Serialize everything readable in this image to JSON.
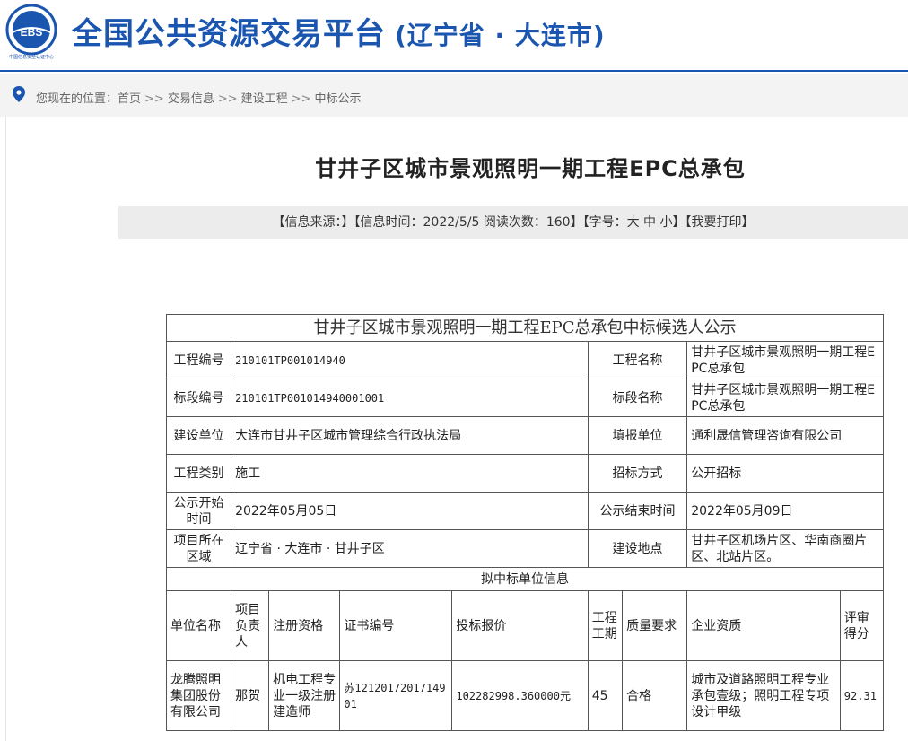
{
  "header": {
    "logo_text": "EBS",
    "logo_caption": "中国信息安全认证中心",
    "site_title": "全国公共资源交易平台",
    "region": "(辽宁省 · 大连市)"
  },
  "breadcrumb": {
    "prefix": "您现在的位置：",
    "items": [
      "首页",
      "交易信息",
      "建设工程",
      "中标公示"
    ],
    "separator": ">>"
  },
  "article": {
    "title": "甘井子区城市景观照明一期工程EPC总承包",
    "info": {
      "source": "【信息来源：】",
      "time": "【信息时间：2022/5/5",
      "views": "阅读次数：160】",
      "font_size_label": "【字号：",
      "font_big": "大",
      "font_mid": "中",
      "font_small": "小】",
      "print": "【我要打印】"
    }
  },
  "notice": {
    "caption": "甘井子区城市景观照明一期工程EPC总承包中标候选人公示",
    "rows": [
      {
        "l1": "工程编号",
        "v1": "210101TP001014940",
        "l2": "工程名称",
        "v2": "甘井子区城市景观照明一期工程EPC总承包"
      },
      {
        "l1": "标段编号",
        "v1": "210101TP001014940001001",
        "l2": "标段名称",
        "v2": "甘井子区城市景观照明一期工程EPC总承包"
      },
      {
        "l1": "建设单位",
        "v1": "大连市甘井子区城市管理综合行政执法局",
        "l2": "填报单位",
        "v2": "通利晟信管理咨询有限公司"
      },
      {
        "l1": "工程类别",
        "v1": "施工",
        "l2": "招标方式",
        "v2": "公开招标"
      },
      {
        "l1": "公示开始时间",
        "v1": "2022年05月05日",
        "l2": "公示结束时间",
        "v2": "2022年05月09日"
      },
      {
        "l1": "项目所在区域",
        "v1": "辽宁省 · 大连市 · 甘井子区",
        "l2": "建设地点",
        "v2": "甘井子区机场片区、华南商圈片区、北站片区。"
      }
    ],
    "section_title": "拟中标单位信息",
    "columns": [
      "单位名称",
      "项目负责人",
      "注册资格",
      "证书编号",
      "投标报价",
      "工程工期",
      "质量要求",
      "企业资质",
      "评审得分"
    ],
    "winner": {
      "name": "龙腾照明集团股份有限公司",
      "manager": "那贺",
      "qualification": "机电工程专业一级注册建造师",
      "cert_no": "苏1212017201714901",
      "bid": "102282998.360000元",
      "duration": "45",
      "quality": "合格",
      "enterprise_qual": "城市及道路照明工程专业承包壹级；照明工程专项设计甲级",
      "score": "92.31"
    }
  },
  "colors": {
    "brand": "#1a56b0",
    "crumb_bg": "#f3f3f3",
    "infobar_bg": "#ececec"
  }
}
